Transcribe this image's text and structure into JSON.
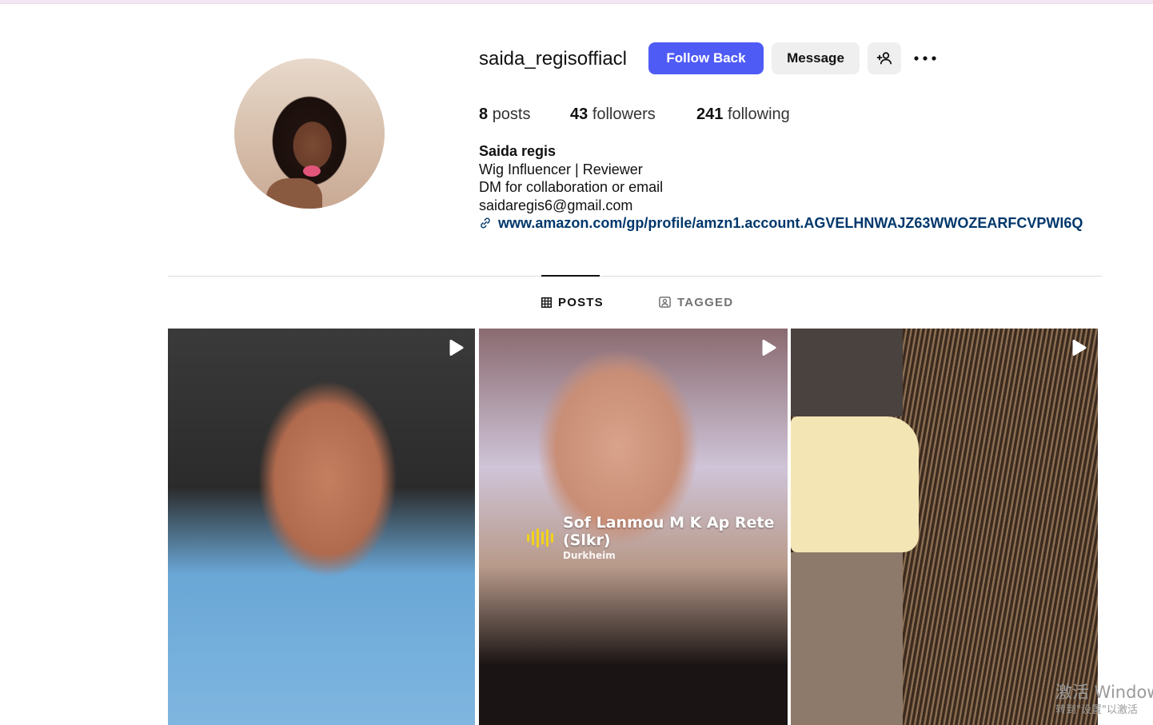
{
  "profile": {
    "username": "saida_regisoffiacl",
    "follow_back_label": "Follow Back",
    "message_label": "Message",
    "add_user_icon": "person-add-icon",
    "more_icon": "more-options-icon",
    "stats": {
      "posts_count": "8",
      "posts_label": "posts",
      "followers_count": "43",
      "followers_label": "followers",
      "following_count": "241",
      "following_label": "following"
    },
    "bio": {
      "name": "Saida regis",
      "line1": "Wig Influencer | Reviewer",
      "line2": "DM for collaboration or email",
      "line3": "saidaregis6@gmail.com",
      "link": "www.amazon.com/gp/profile/amzn1.account.AGVELHNWAJZ63WWOZEARFCVPWI6Q"
    }
  },
  "tabs": [
    {
      "label": "POSTS",
      "icon": "grid-icon",
      "active": true
    },
    {
      "label": "TAGGED",
      "icon": "tagged-icon",
      "active": false
    }
  ],
  "posts": [
    {
      "type": "reel",
      "icon": "reel-icon"
    },
    {
      "type": "reel",
      "icon": "reel-icon",
      "music_title": "Sof Lanmou M K Ap Rete (Slkr)",
      "music_artist": "Durkheim"
    },
    {
      "type": "reel",
      "icon": "reel-icon"
    }
  ],
  "watermark": {
    "line1": "激活 Window",
    "line2": "转到\"设置\"以激活"
  },
  "colors": {
    "follow_button": "#4f5bf5",
    "link": "#00376b",
    "secondary_button": "#efefef"
  }
}
